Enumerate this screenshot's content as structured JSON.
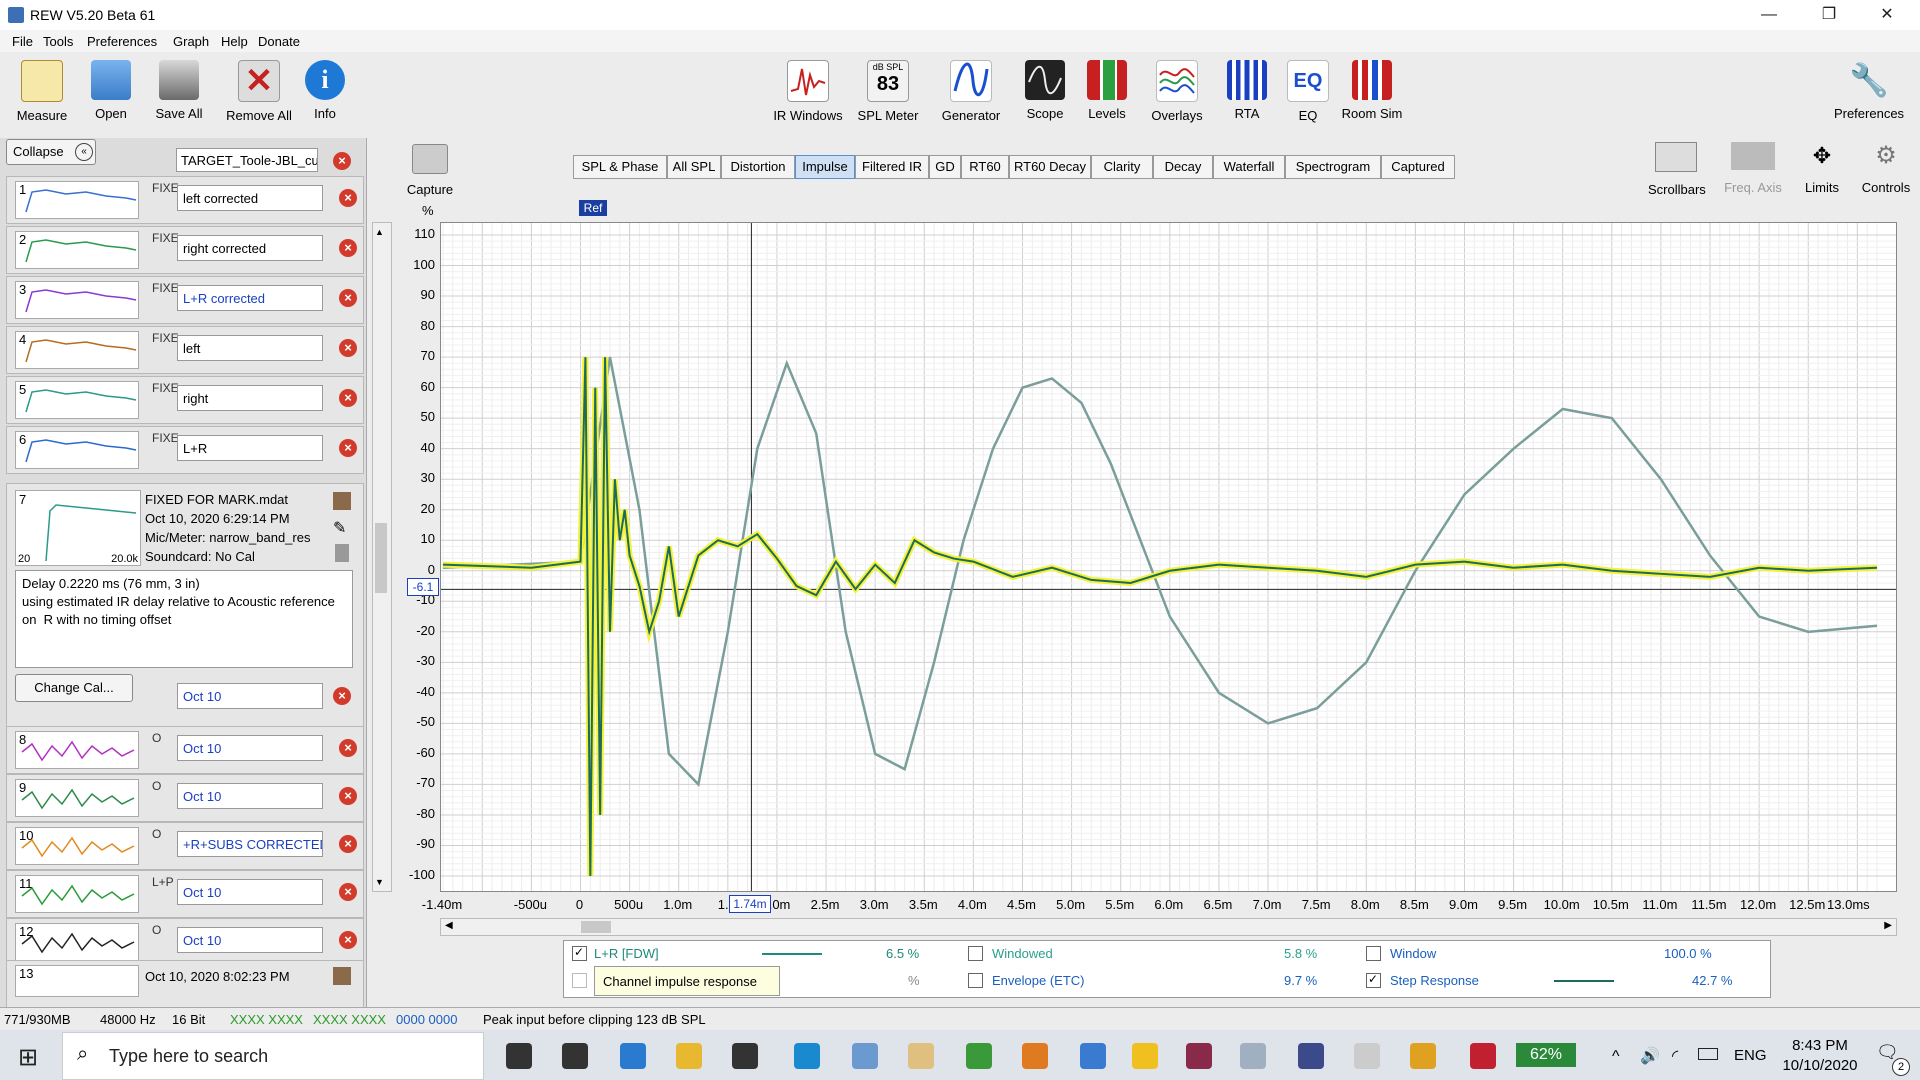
{
  "window": {
    "title": "REW V5.20 Beta 61",
    "minimize": "—",
    "maximize": "❐",
    "close": "✕"
  },
  "menu": [
    "File",
    "Tools",
    "Preferences",
    "Graph",
    "Help",
    "Donate"
  ],
  "toolbar_left": [
    {
      "label": "Measure",
      "icon": "measure-icon",
      "color": "#f6e8a8"
    },
    {
      "label": "Open",
      "icon": "open-folder-icon",
      "color": "#4f8ed8"
    },
    {
      "label": "Save All",
      "icon": "save-all-icon",
      "color": "#8a8a8a"
    },
    {
      "label": "Remove All",
      "icon": "remove-all-icon",
      "color": "#c94040"
    },
    {
      "label": "Info",
      "icon": "info-icon",
      "color": "#1e78d6"
    }
  ],
  "toolbar_center": [
    {
      "label": "IR Windows",
      "icon": "ir-windows-icon"
    },
    {
      "label": "SPL Meter",
      "icon": "spl-meter-icon",
      "value": "83",
      "unit": "dB SPL"
    },
    {
      "label": "Generator",
      "icon": "generator-icon"
    },
    {
      "label": "Scope",
      "icon": "scope-icon"
    },
    {
      "label": "Levels",
      "icon": "levels-icon"
    },
    {
      "label": "Overlays",
      "icon": "overlays-icon"
    },
    {
      "label": "RTA",
      "icon": "rta-icon"
    },
    {
      "label": "EQ",
      "icon": "eq-icon"
    },
    {
      "label": "Room Sim",
      "icon": "room-sim-icon"
    }
  ],
  "toolbar_right": {
    "label": "Preferences",
    "icon": "wrench-icon"
  },
  "left_panel": {
    "collapse_label": "Collapse",
    "top_name": "TARGET_Toole-JBL_cu",
    "measurements": [
      {
        "num": "1",
        "tag": "FIXE",
        "name": "left corrected",
        "color": "#3a6fd0"
      },
      {
        "num": "2",
        "tag": "FIXE",
        "name": "right corrected",
        "color": "#2a9a4a"
      },
      {
        "num": "3",
        "tag": "FIXE",
        "name": "L+R corrected",
        "color": "#8a3ad0",
        "blue": true
      },
      {
        "num": "4",
        "tag": "FIXE",
        "name": "left",
        "color": "#b86b20"
      },
      {
        "num": "5",
        "tag": "FIXE",
        "name": "right",
        "color": "#2a9a8a"
      },
      {
        "num": "6",
        "tag": "FIXE",
        "name": "L+R",
        "color": "#2a6ad0"
      }
    ],
    "selected": {
      "num": "7",
      "file": "FIXED FOR MARK.mdat",
      "date": "Oct 10, 2020 6:29:14 PM",
      "mic": "Mic/Meter: narrow_band_res",
      "soundcard": "Soundcard: No Cal",
      "axis_low": "20",
      "axis_high": "20.0k",
      "notes": "Delay 0.2220 ms (76 mm, 3 in)\nusing estimated IR delay relative to Acoustic reference on  R with no timing offset",
      "change_cal": "Change Cal..."
    },
    "selected_name": "Oct 10",
    "lower": [
      {
        "num": "8",
        "tag": "O",
        "name": "Oct 10",
        "color": "#b030c0"
      },
      {
        "num": "9",
        "tag": "O",
        "name": "Oct 10",
        "color": "#2a8a4a"
      },
      {
        "num": "10",
        "tag": "O",
        "name": "+R+SUBS CORRECTED",
        "color": "#e08a20"
      },
      {
        "num": "11",
        "tag": "L+P",
        "name": "Oct 10",
        "color": "#2a9a3a"
      },
      {
        "num": "12",
        "tag": "O",
        "name": "Oct 10",
        "color": "#222222"
      }
    ],
    "last": {
      "num": "13",
      "date": "Oct 10, 2020 8:02:23 PM"
    }
  },
  "capture": {
    "label": "Capture",
    "icon": "camera-icon"
  },
  "tabs": [
    "SPL & Phase",
    "All SPL",
    "Distortion",
    "Impulse",
    "Filtered IR",
    "GD",
    "RT60",
    "RT60 Decay",
    "Clarity",
    "Decay",
    "Waterfall",
    "Spectrogram",
    "Captured"
  ],
  "active_tab": "Impulse",
  "graph_tools": [
    {
      "label": "Scrollbars",
      "icon": "scrollbars-icon"
    },
    {
      "label": "Freq. Axis",
      "icon": "freq-axis-icon",
      "disabled": true
    },
    {
      "label": "Limits",
      "icon": "limits-icon"
    },
    {
      "label": "Controls",
      "icon": "gear-icon"
    }
  ],
  "graph": {
    "y_unit": "%",
    "ref_label": "Ref",
    "cursor_y": "-6.1",
    "cursor_x": "1.74m",
    "y_ticks": [
      "110",
      "100",
      "90",
      "80",
      "70",
      "60",
      "50",
      "40",
      "30",
      "20",
      "10",
      "0",
      "-10",
      "-20",
      "-30",
      "-40",
      "-50",
      "-60",
      "-70",
      "-80",
      "-90",
      "-100"
    ],
    "x_ticks": [
      "-1.40m",
      "-500u",
      "0",
      "500u",
      "1.0m",
      "1.5",
      "",
      "2.0m",
      "2.5m",
      "3.0m",
      "3.5m",
      "4.0m",
      "4.5m",
      "5.0m",
      "5.5m",
      "6.0m",
      "6.5m",
      "7.0m",
      "7.5m",
      "8.0m",
      "8.5m",
      "9.0m",
      "9.5m",
      "10.0m",
      "10.5m",
      "11.0m",
      "11.5m",
      "12.0m",
      "12.5m",
      "13.0ms"
    ]
  },
  "chart_data": {
    "type": "line",
    "xlabel": "",
    "ylabel": "%",
    "xlim": [
      -1.4,
      13.2
    ],
    "ylim": [
      -105,
      112
    ],
    "series": [
      {
        "name": "L+R [FDW]",
        "color": "#1d6b5c",
        "x": [
          -1.4,
          -0.5,
          0,
          0.05,
          0.1,
          0.15,
          0.2,
          0.25,
          0.3,
          0.35,
          0.4,
          0.45,
          0.5,
          0.6,
          0.7,
          0.8,
          0.9,
          1.0,
          1.2,
          1.4,
          1.6,
          1.8,
          2.0,
          2.2,
          2.4,
          2.6,
          2.8,
          3.0,
          3.2,
          3.4,
          3.6,
          3.8,
          4.0,
          4.4,
          4.8,
          5.2,
          5.6,
          6.0,
          6.5,
          7.0,
          7.5,
          8.0,
          8.5,
          9.0,
          9.5,
          10.0,
          10.5,
          11.0,
          11.5,
          12.0,
          12.5,
          13.2
        ],
        "y": [
          2,
          1,
          3,
          70,
          -100,
          60,
          -80,
          70,
          -20,
          30,
          10,
          20,
          5,
          -5,
          -20,
          -10,
          8,
          -15,
          5,
          10,
          8,
          12,
          4,
          -5,
          -8,
          3,
          -6,
          2,
          -4,
          10,
          6,
          4,
          3,
          -2,
          1,
          -3,
          -4,
          0,
          2,
          1,
          0,
          -2,
          2,
          3,
          1,
          2,
          0,
          -1,
          -2,
          1,
          0,
          1
        ]
      },
      {
        "name": "Step Response",
        "color": "#7a9e9a",
        "x": [
          -1.4,
          0,
          0.3,
          0.6,
          0.9,
          1.2,
          1.5,
          1.8,
          2.1,
          2.4,
          2.7,
          3.0,
          3.3,
          3.6,
          3.9,
          4.2,
          4.5,
          4.8,
          5.1,
          5.4,
          5.7,
          6.0,
          6.5,
          7.0,
          7.5,
          8.0,
          8.5,
          9.0,
          9.5,
          10.0,
          10.5,
          11.0,
          11.5,
          12.0,
          12.5,
          13.2
        ],
        "y": [
          1,
          3,
          70,
          20,
          -60,
          -70,
          -20,
          40,
          68,
          45,
          -20,
          -60,
          -65,
          -30,
          10,
          40,
          60,
          63,
          55,
          35,
          10,
          -15,
          -40,
          -50,
          -45,
          -30,
          0,
          25,
          40,
          53,
          50,
          30,
          5,
          -15,
          -20,
          -18
        ]
      }
    ]
  },
  "legend": {
    "row1": [
      {
        "label": "L+R [FDW]",
        "checked": true,
        "value": "6.5 %",
        "color": "#1d8a7a"
      },
      {
        "label": "Windowed",
        "checked": false,
        "value": "5.8 %",
        "color": "#2aa08a"
      },
      {
        "label": "Window",
        "checked": false,
        "value": "100.0 %",
        "color": "#1a5fc0"
      }
    ],
    "row2": [
      {
        "label": "Channel impulse response",
        "checked": false,
        "value": "%",
        "tooltip": true
      },
      {
        "label": "Envelope (ETC)",
        "checked": false,
        "value": "9.7 %",
        "color": "#1a5fc0"
      },
      {
        "label": "Step Response",
        "checked": true,
        "value": "42.7 %",
        "color": "#1a5fc0"
      }
    ]
  },
  "status": {
    "memory": "771/930MB",
    "rate": "48000 Hz",
    "bits": "16 Bit",
    "levels1": "XXXX XXXX",
    "levels2": "XXXX XXXX",
    "levels3": "0000 0000",
    "peak": "Peak input before clipping 123 dB SPL"
  },
  "taskbar": {
    "search_placeholder": "Type here to search",
    "battery": "62%",
    "lang": "ENG",
    "time": "8:43 PM",
    "date": "10/10/2020",
    "notif": "2"
  }
}
